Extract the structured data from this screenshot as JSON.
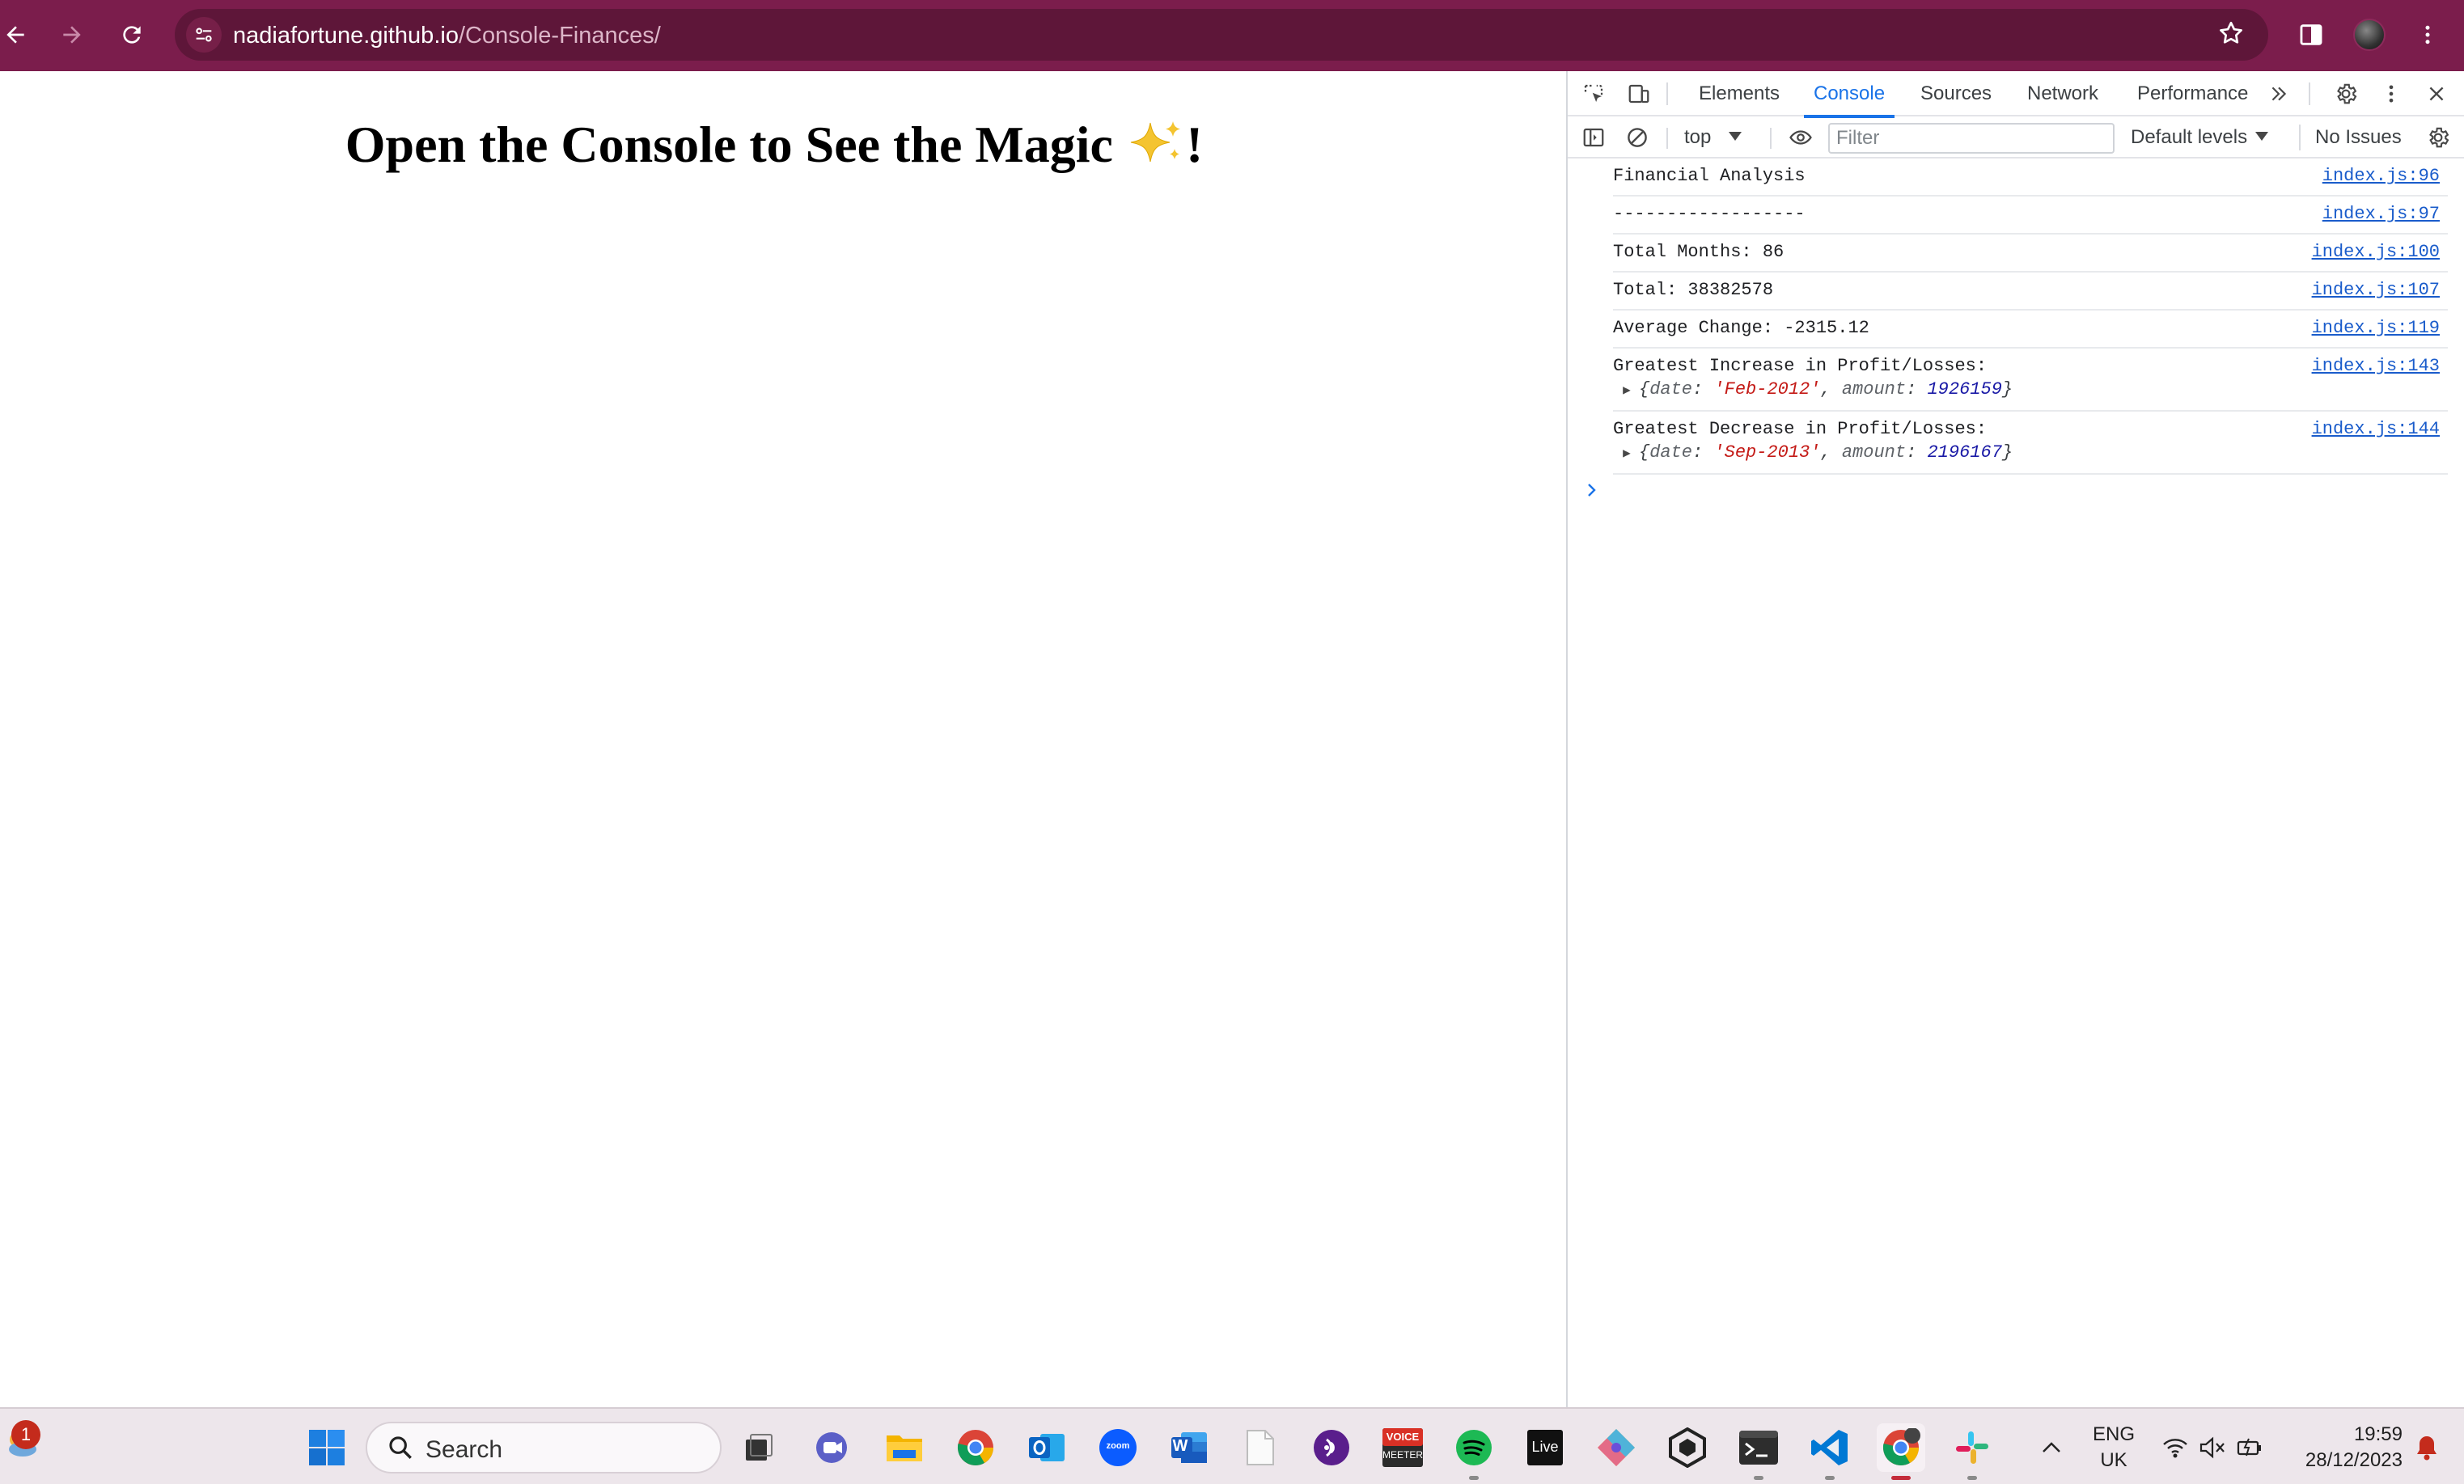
{
  "browser": {
    "url_host": "nadiafortune.github.io",
    "url_path": "/Console-Finances/",
    "icons": [
      "back-arrow-icon",
      "forward-arrow-icon",
      "reload-icon",
      "site-settings-icon",
      "star-icon",
      "side-panel-icon",
      "profile-avatar",
      "more-vert-icon"
    ]
  },
  "page": {
    "heading": "Open the Console to See the Magic",
    "heading_suffix": "!"
  },
  "devtools": {
    "tabs": [
      {
        "label": "Elements",
        "active": false
      },
      {
        "label": "Console",
        "active": true
      },
      {
        "label": "Sources",
        "active": false
      },
      {
        "label": "Network",
        "active": false
      },
      {
        "label": "Performance",
        "active": false
      }
    ],
    "toolbar": {
      "context": "top",
      "filter_placeholder": "Filter",
      "levels": "Default levels",
      "issues": "No Issues"
    },
    "logs": [
      {
        "text": "Financial Analysis",
        "source": "index.js:96"
      },
      {
        "text": "------------------",
        "source": "index.js:97"
      },
      {
        "text": "Total Months: 86",
        "source": "index.js:100"
      },
      {
        "text": "Total: 38382578",
        "source": "index.js:107"
      },
      {
        "text": "Average Change: -2315.12",
        "source": "index.js:119"
      },
      {
        "text": "Greatest Increase in Profit/Losses:",
        "source": "index.js:143",
        "object": {
          "date_key": "date",
          "date": "'Feb-2012'",
          "amount_key": "amount",
          "amount": "1926159"
        }
      },
      {
        "text": "Greatest Decrease in Profit/Losses:",
        "source": "index.js:144",
        "object": {
          "date_key": "date",
          "date": "'Sep-2013'",
          "amount_key": "amount",
          "amount": "2196167"
        }
      }
    ]
  },
  "taskbar": {
    "search_label": "Search",
    "notification_count": "1",
    "language_line1": "ENG",
    "language_line2": "UK",
    "time": "19:59",
    "date": "28/12/2023",
    "apps": [
      "start-icon",
      "task-view-icon",
      "teams-icon",
      "file-explorer-icon",
      "chrome-icon",
      "outlook-icon",
      "zoom-icon",
      "word-icon",
      "notepad-icon",
      "podcast-icon",
      "voicemeeter-icon",
      "spotify-icon",
      "live-icon",
      "git-icon",
      "unity-icon",
      "terminal-icon",
      "vscode-icon",
      "chrome-active-icon",
      "slack-icon"
    ],
    "app_labels": {
      "zoom": "zoom",
      "voicemeeter_top": "VOICE",
      "voicemeeter_bottom": "MEETER",
      "live": "Live",
      "word": "W"
    },
    "accent": "#7b1d4c"
  }
}
